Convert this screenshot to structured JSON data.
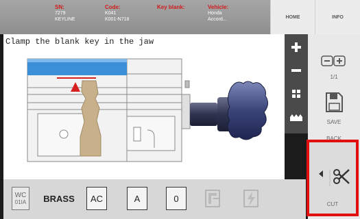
{
  "header": {
    "sn_label": "SN:",
    "sn_value_1": "7279",
    "sn_value_2": "KEYLINE",
    "code_label": "Code:",
    "code_value_1": "K041",
    "code_value_2": "K001-N718",
    "key_blank_label": "Key blank:",
    "vehicle_label": "Vehicle:",
    "vehicle_value_1": "Honda",
    "vehicle_value_2": "Accord...",
    "home_label": "HOME",
    "info_label": "INFO"
  },
  "instruction": "Clamp the blank key in the jaw",
  "zoom_bar": {
    "zoom_in_icon": "plus-icon",
    "zoom_out_icon": "minus-icon",
    "grid_icon": "grid-icon",
    "profile_icon": "key-profile-icon"
  },
  "side": {
    "page_indicator": "1/1",
    "save_label": "SAVE",
    "back_label": "BACK"
  },
  "bottom_toolbar": {
    "wc_top": "WC",
    "wc_bottom": "01IA",
    "material": "BRASS",
    "ac": "AC",
    "a": "A",
    "zero": "0"
  },
  "cut": {
    "label": "CUT"
  },
  "colors": {
    "key_blade": "#3a8fd8",
    "marker": "#d61f1f",
    "highlight_border": "#e01010"
  }
}
